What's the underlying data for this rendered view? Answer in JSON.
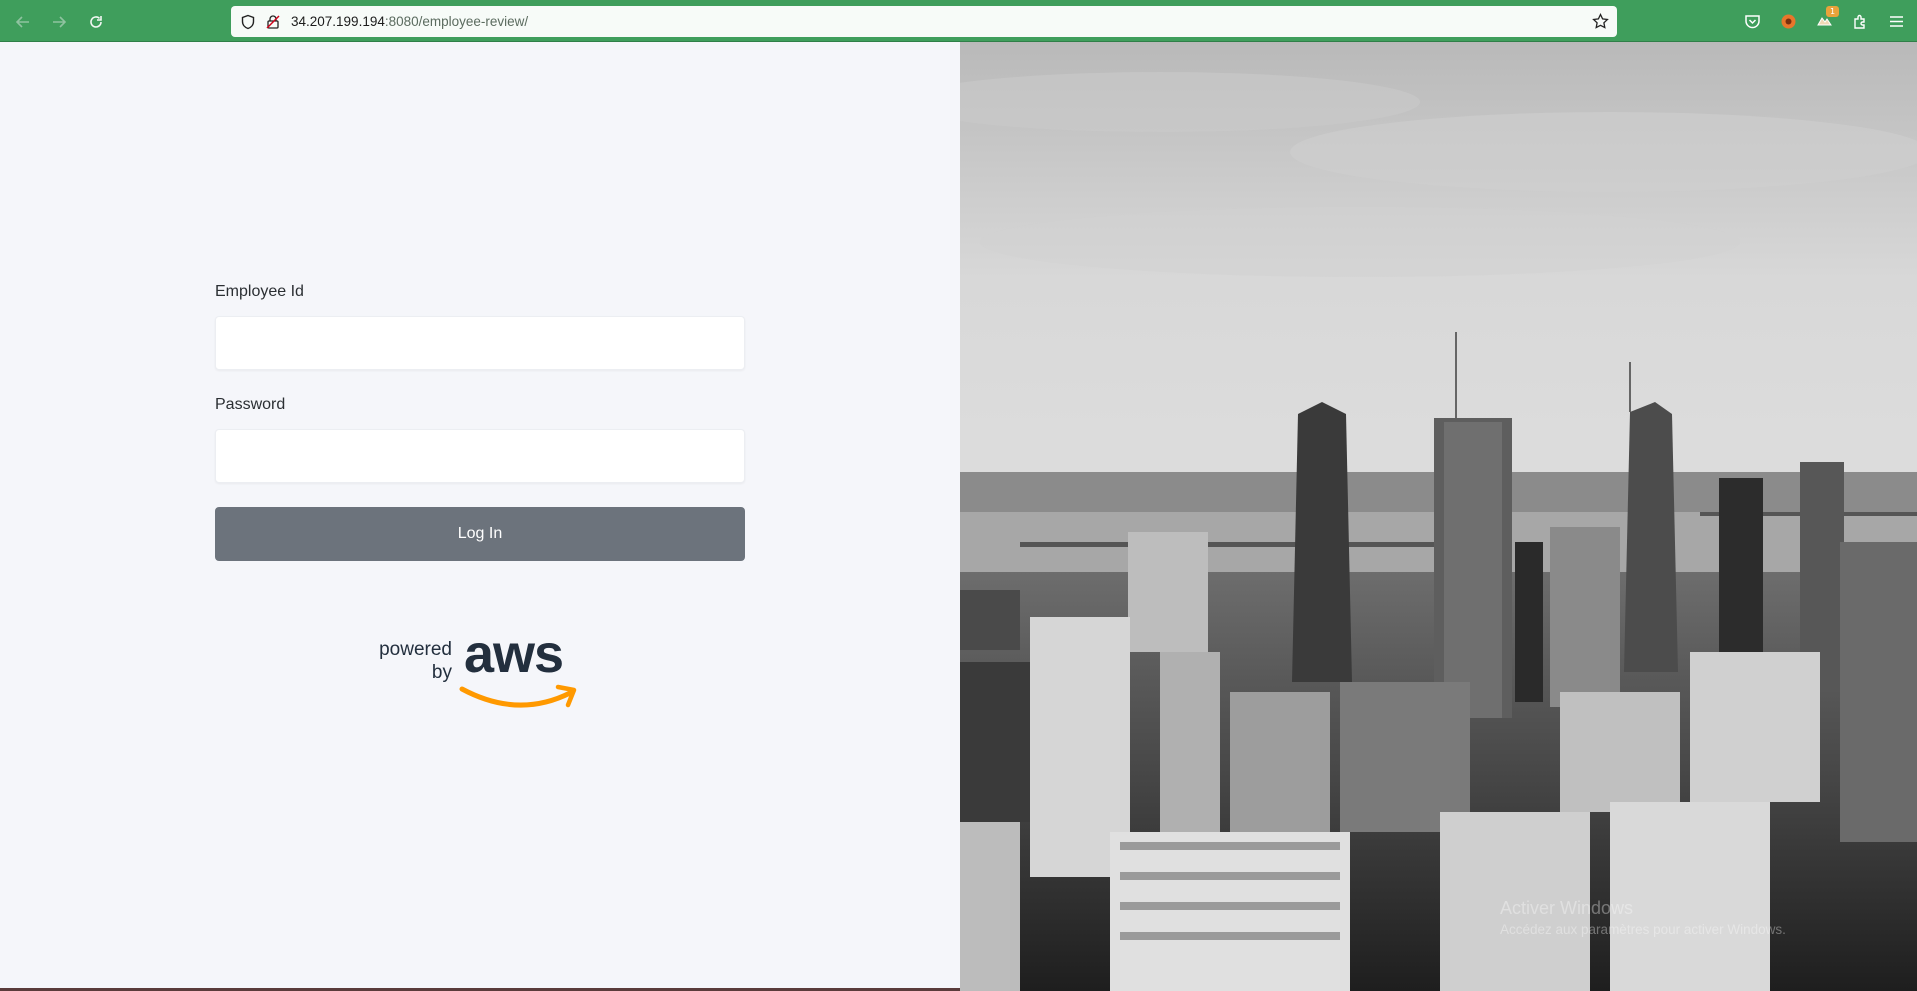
{
  "browser": {
    "url_host": "34.207.199.194",
    "url_rest": ":8080/employee-review/",
    "icons": [
      "back-icon",
      "forward-icon",
      "reload-icon",
      "shield-icon",
      "insecure-lock-icon",
      "bookmark-star-icon",
      "pocket-icon",
      "extension-badge-icon",
      "extension-icon",
      "puzzle-icon",
      "menu-icon"
    ],
    "extension_badge_count": "1",
    "toolbar_color": "#3f9e5c"
  },
  "login": {
    "employee_id_label": "Employee Id",
    "employee_id_value": "",
    "password_label": "Password",
    "password_value": "",
    "login_button": "Log In",
    "button_color": "#6c737c"
  },
  "branding": {
    "powered_by_line1": "powered",
    "powered_by_line2": "by",
    "aws_text": "aws",
    "aws_smile_color": "#ff9900",
    "aws_text_color": "#232f3e"
  },
  "hero": {
    "description": "black-and-white city skyline photo"
  },
  "windows_watermark": {
    "line1": "Activer Windows",
    "line2": "Accédez aux paramètres pour activer Windows."
  }
}
